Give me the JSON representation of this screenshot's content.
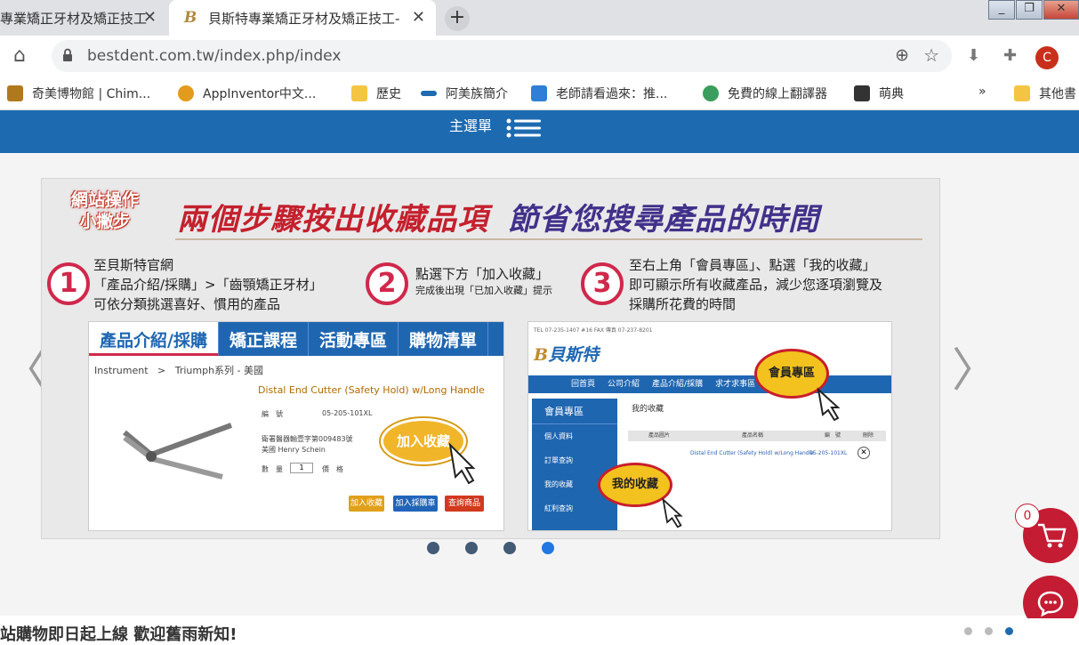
{
  "browser": {
    "tabs": [
      {
        "title": "專業矯正牙材及矯正技工",
        "active": false
      },
      {
        "title": "貝斯特專業矯正牙材及矯正技工-",
        "active": true
      }
    ],
    "new_tab": "+",
    "url": "bestdent.com.tw/index.php/index",
    "profile_initial": "C",
    "window_controls": [
      "_",
      "❐",
      "✕"
    ]
  },
  "bookmarks": [
    {
      "label": "奇美博物館 | Chim...",
      "icon": "chimei-icon",
      "color": "#b0791e"
    },
    {
      "label": "AppInventor中文...",
      "icon": "appinventor-icon",
      "color": "#e39b1b"
    },
    {
      "label": "歷史",
      "icon": "folder-icon",
      "color": "#f4c542"
    },
    {
      "label": "阿美族簡介",
      "icon": "flag-icon",
      "color": "#1d6ab0"
    },
    {
      "label": "老師請看過來：推...",
      "icon": "chart-icon",
      "color": "#2f7fd6"
    },
    {
      "label": "免費的線上翻譯器",
      "icon": "globe-icon",
      "color": "#3a9d5d"
    },
    {
      "label": "萌典",
      "icon": "moedict-icon",
      "color": "#333333"
    }
  ],
  "bookmarks_more": "»",
  "bookmarks_other": "其他書",
  "site": {
    "menu_label": "主選單",
    "slide": {
      "badge_line1": "網站操作",
      "badge_line2": "小撇步",
      "headline_red": "兩個步驟按出收藏品項",
      "headline_blue": "節省您搜尋產品的時間",
      "step1_num": "1",
      "step1_lines": [
        "至貝斯特官網",
        "「產品介紹/採購」>「齒顎矯正牙材」",
        "可依分類挑選喜好、慣用的產品"
      ],
      "step2_num": "2",
      "step2_line1": "點選下方「加入收藏」",
      "step2_line2": "完成後出現「已加入收藏」提示",
      "step3_num": "3",
      "step3_lines": [
        "至右上角「會員專區」、點選「我的收藏」",
        "即可顯示所有收藏產品，減少您逐項瀏覽及",
        "採購所花費的時間"
      ],
      "shot1": {
        "nav": [
          "產品介紹/採購",
          "矯正課程",
          "活動專區",
          "購物清單"
        ],
        "breadcrumb": "Instrument   >   Triumph系列 - 美國",
        "product_title": "Distal End Cutter (Safety Hold) w/Long Handle",
        "code_label": "編　號",
        "code_value": "05-205-101XL",
        "license": "衛署醫器輸壹字第009483號",
        "vendor": "美國 Henry Schein",
        "qty_label": "數　量",
        "qty_value": "1",
        "price_label": "價　格",
        "bubble": "加入收藏",
        "btn_add": "加入收藏",
        "btn_cart": "加入採購車",
        "btn_inquiry": "查詢商品"
      },
      "shot2": {
        "brand": "貝斯特",
        "topbar": "TEL 07-235-1407 #16   FAX 傳真 07-237-8201",
        "nav": [
          "回首頁",
          "公司介紹",
          "產品介紹/採購",
          "求才求事區"
        ],
        "side_title": "會員專區",
        "side_items": [
          "個人資料",
          "訂單查詢",
          "我的收藏",
          "紅利查詢"
        ],
        "list_title": "我的收藏",
        "cols": [
          "產品圖片",
          "產品名稱",
          "編　號",
          "刪除"
        ],
        "row_name": "Distal End Cutter (Safety Hold) w/Long Handle",
        "row_code": "05-205-101XL",
        "bubble_member": "會員專區",
        "bubble_fav": "我的收藏"
      }
    },
    "carousel_dots": 4,
    "carousel_active": 4,
    "ticker": "站購物即日起上線 歡迎舊雨新知!",
    "ticker_dots": 3,
    "cart_count": "0"
  }
}
